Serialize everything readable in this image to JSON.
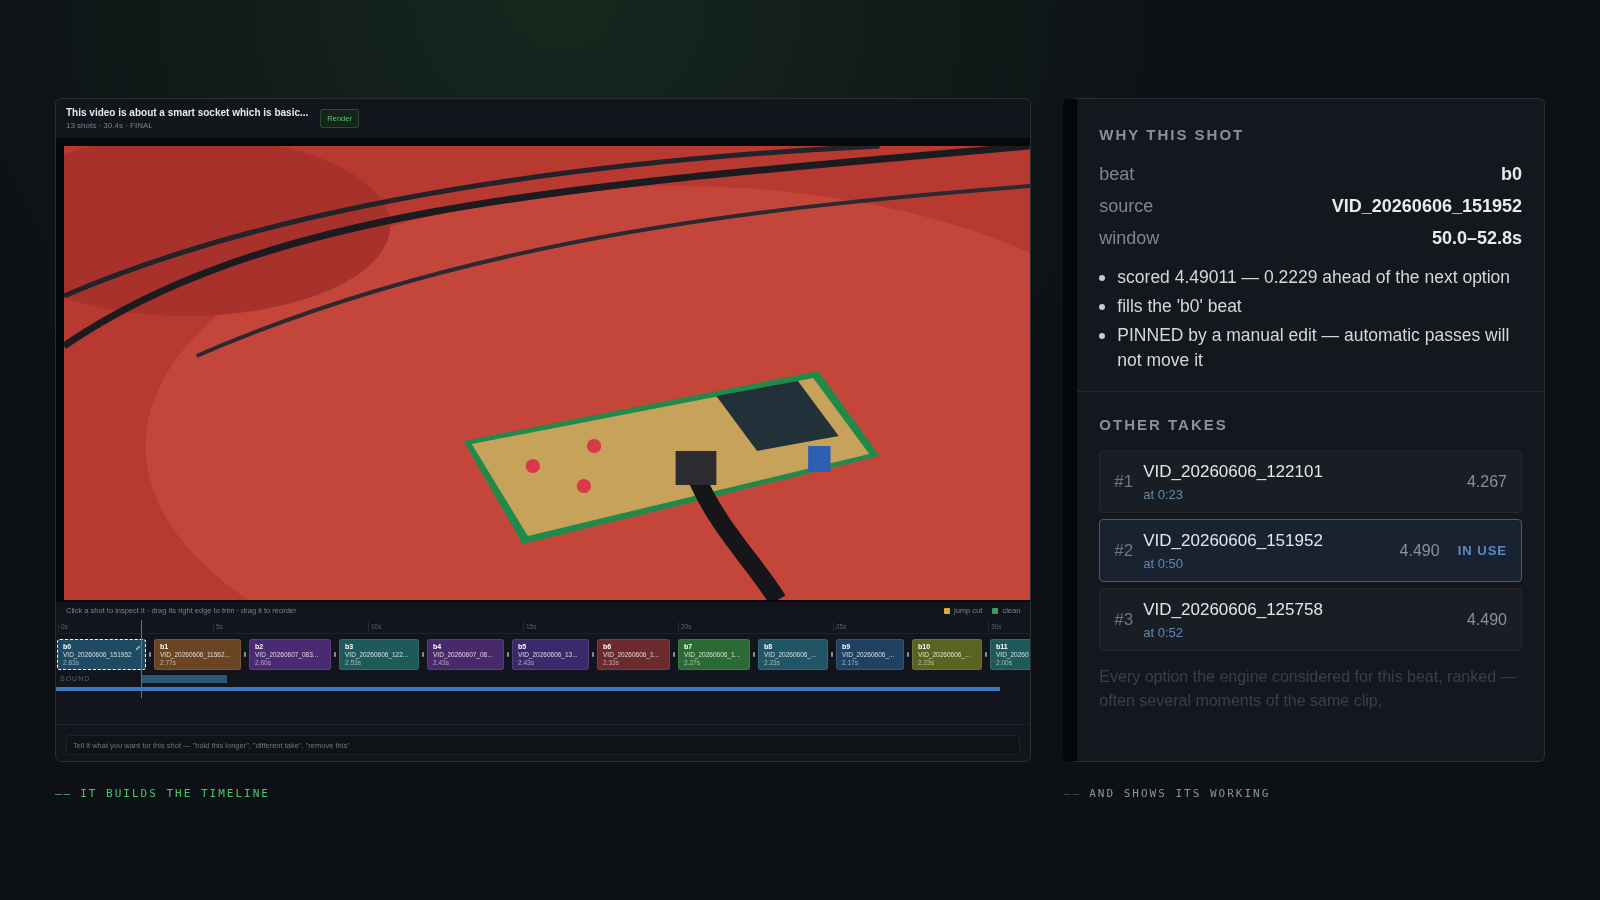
{
  "editor": {
    "title": "This video is about a smart socket which is basic...",
    "meta": "13 shots · 30.4s · FINAL",
    "render_button": "Render",
    "hint": "Click a shot to inspect it · drag its right edge to trim · drag it to reorder",
    "legend": [
      {
        "label": "jump cut",
        "color": "#e0a93a"
      },
      {
        "label": "clean",
        "color": "#3f9a6a"
      }
    ],
    "ruler": [
      "0s",
      "5s",
      "10s",
      "15s",
      "20s",
      "25s",
      "30s"
    ],
    "shots": [
      {
        "beat": "b0",
        "clip": "VID_20260606_151952",
        "duration": "2.83s",
        "color": "#1e4a63",
        "selected": true,
        "pinned": true
      },
      {
        "beat": "b1",
        "clip": "VID_20260606_11562...",
        "duration": "2.77s",
        "color": "#6b4424",
        "selected": false,
        "pinned": false
      },
      {
        "beat": "b2",
        "clip": "VID_20260607_083...",
        "duration": "2.60s",
        "color": "#4a2a72",
        "selected": false,
        "pinned": false
      },
      {
        "beat": "b3",
        "clip": "VID_20260606_122...",
        "duration": "2.53s",
        "color": "#1e5a5a",
        "selected": false,
        "pinned": false
      },
      {
        "beat": "b4",
        "clip": "VID_20260607_08...",
        "duration": "2.43s",
        "color": "#48296c",
        "selected": false,
        "pinned": false
      },
      {
        "beat": "b5",
        "clip": "VID_20260606_13...",
        "duration": "2.43s",
        "color": "#3a2a6c",
        "selected": false,
        "pinned": false
      },
      {
        "beat": "b6",
        "clip": "VID_20260606_1...",
        "duration": "2.33s",
        "color": "#6c2a2e",
        "selected": false,
        "pinned": false
      },
      {
        "beat": "b7",
        "clip": "VID_20260606_1...",
        "duration": "2.27s",
        "color": "#2a6a34",
        "selected": false,
        "pinned": false
      },
      {
        "beat": "b8",
        "clip": "VID_20260606_...",
        "duration": "2.23s",
        "color": "#1f5564",
        "selected": false,
        "pinned": false
      },
      {
        "beat": "b9",
        "clip": "VID_20260606_...",
        "duration": "2.17s",
        "color": "#1f4262",
        "selected": false,
        "pinned": false
      },
      {
        "beat": "b10",
        "clip": "VID_20260606_...",
        "duration": "2.23s",
        "color": "#5a6420",
        "selected": false,
        "pinned": false
      },
      {
        "beat": "b11",
        "clip": "VID_20260",
        "duration": "2.00s",
        "color": "#1f5a5a",
        "selected": false,
        "pinned": false
      }
    ],
    "sound_label": "SOUND",
    "prompt_placeholder": "Tell it what you want for this shot — \"hold this longer\", \"different take\", \"remove this\""
  },
  "inspector": {
    "heading": "WHY THIS SHOT",
    "facts": [
      {
        "label": "beat",
        "value": "b0"
      },
      {
        "label": "source",
        "value": "VID_20260606_151952"
      },
      {
        "label": "window",
        "value": "50.0–52.8s"
      }
    ],
    "reasons": [
      "scored 4.49011 — 0.2229 ahead of the next option",
      "fills the 'b0' beat",
      "PINNED by a manual edit — automatic passes will not move it"
    ],
    "takes_heading": "OTHER TAKES",
    "takes": [
      {
        "rank": "#1",
        "clip": "VID_20260606_122101",
        "at": "at 0:23",
        "score": "4.267",
        "selected": false
      },
      {
        "rank": "#2",
        "clip": "VID_20260606_151952",
        "at": "at 0:50",
        "score": "4.490",
        "badge": "IN USE",
        "selected": true
      },
      {
        "rank": "#3",
        "clip": "VID_20260606_125758",
        "at": "at 0:52",
        "score": "4.490",
        "selected": false
      }
    ],
    "note": "Every option the engine considered for this beat, ranked — often several moments of the same clip,"
  },
  "captions": [
    {
      "text": "IT BUILDS THE TIMELINE",
      "dash": "——",
      "accent": true
    },
    {
      "text": "AND SHOWS ITS WORKING",
      "dash": "——",
      "accent": false
    }
  ]
}
